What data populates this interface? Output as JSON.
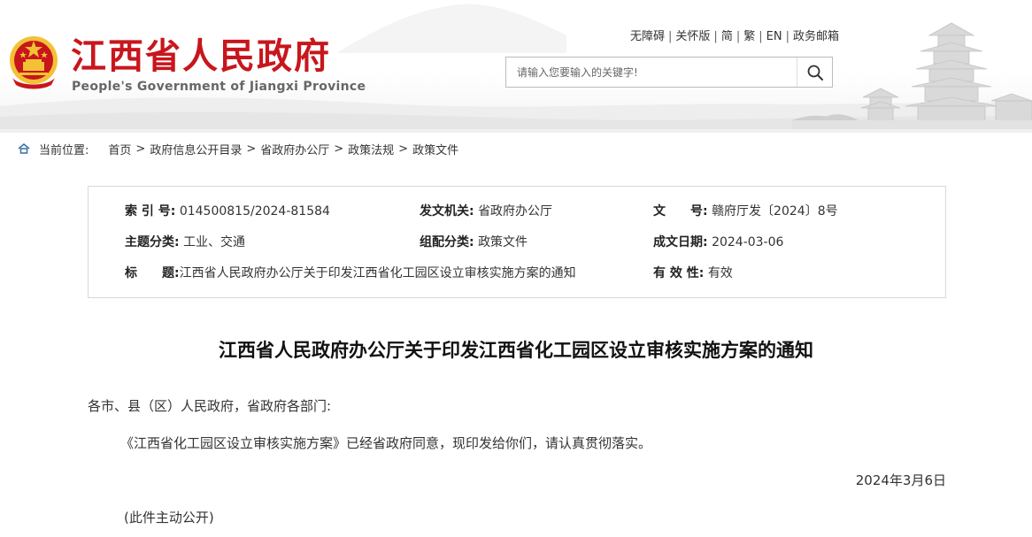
{
  "header": {
    "site_title": "江西省人民政府",
    "site_subtitle": "People's Government of Jiangxi Province",
    "top_links": [
      "无障碍",
      "关怀版",
      "简",
      "繁",
      "EN",
      "政务邮箱"
    ],
    "search_placeholder": "请输入您要输入的关键字!"
  },
  "breadcrumb": {
    "label": "当前位置:",
    "items": [
      "首页",
      "政府信息公开目录",
      "省政府办公厅",
      "政策法规",
      "政策文件"
    ]
  },
  "info": {
    "index_no": {
      "label": "索 引 号:",
      "value": "014500815/2024-81584"
    },
    "issuer": {
      "label": "发文机关:",
      "value": "省政府办公厅"
    },
    "doc_no": {
      "label": "文　　号:",
      "value": "赣府厅发〔2024〕8号"
    },
    "topic": {
      "label": "主题分类:",
      "value": "工业、交通"
    },
    "category": {
      "label": "组配分类:",
      "value": "政策文件"
    },
    "date": {
      "label": "成文日期:",
      "value": "2024-03-06"
    },
    "title": {
      "label": "标　　题:",
      "value": "江西省人民政府办公厅关于印发江西省化工园区设立审核实施方案的通知"
    },
    "validity": {
      "label": "有 效 性:",
      "value": "有效"
    }
  },
  "article": {
    "title": "江西省人民政府办公厅关于印发江西省化工园区设立审核实施方案的通知",
    "salutation": "各市、县（区）人民政府，省政府各部门:",
    "body": "《江西省化工园区设立审核实施方案》已经省政府同意，现印发给你们，请认真贯彻落实。",
    "date": "2024年3月6日",
    "note": "(此件主动公开)"
  },
  "colors": {
    "brand_red": "#c8161d",
    "emblem_gold": "#f3c234"
  }
}
